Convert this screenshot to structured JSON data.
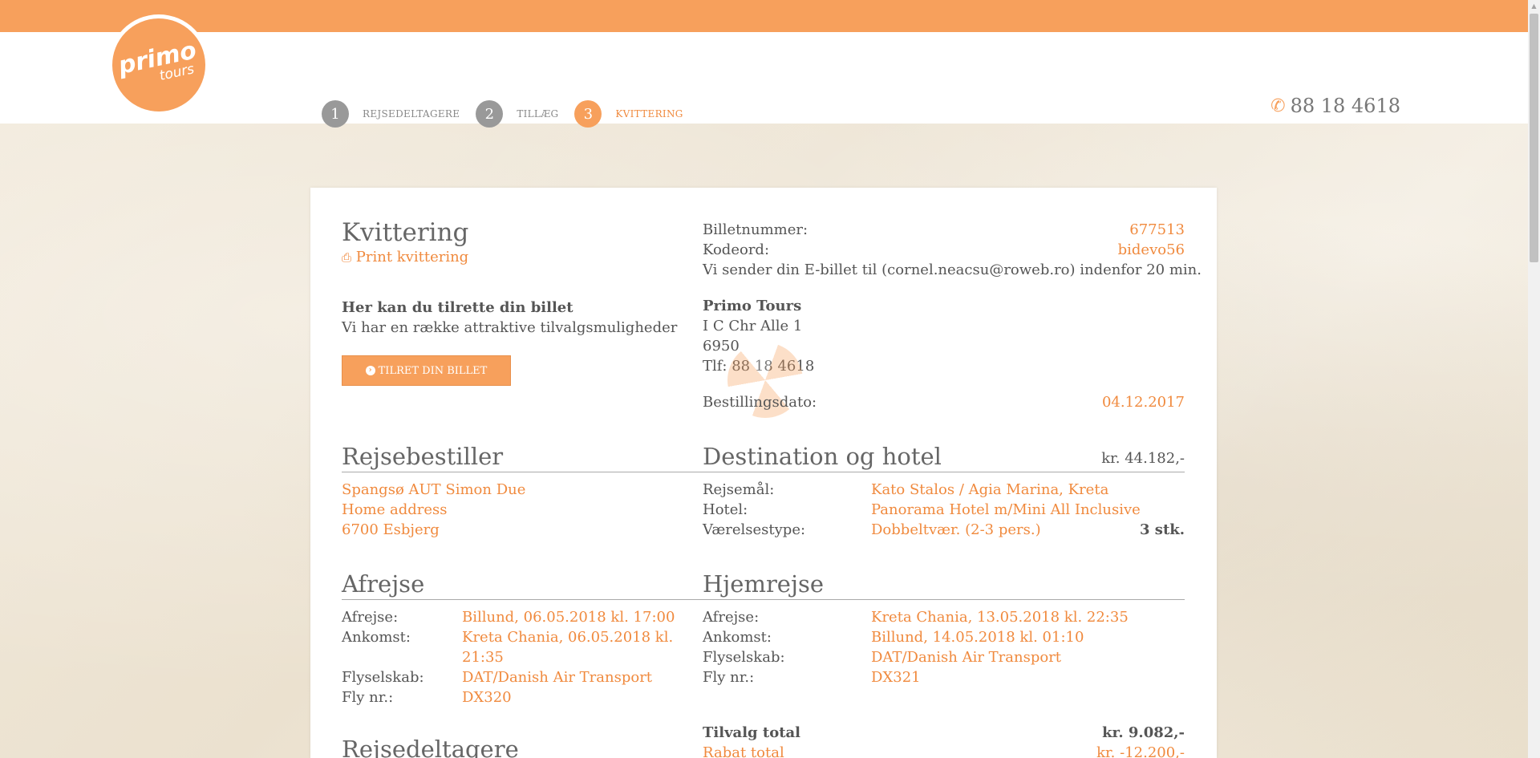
{
  "header": {
    "logo_line1": "primo",
    "logo_line2": "tours",
    "steps": [
      {
        "num": "1",
        "label": "REJSEDELTAGERE"
      },
      {
        "num": "2",
        "label": "TILLÆG"
      },
      {
        "num": "3",
        "label": "KVITTERING"
      }
    ],
    "phone": "88 18 4618",
    "phone_icon": "phone-icon"
  },
  "receipt": {
    "title": "Kvittering",
    "print_label": "Print kvittering",
    "customize_title": "Her kan du tilrette din billet",
    "customize_sub": "Vi har en række attraktive tilvalgsmuligheder",
    "customize_button": "TILRET DIN BILLET",
    "ticket_label": "Billetnummer:",
    "ticket_value": "677513",
    "code_label": "Kodeord:",
    "code_value": "bidevo56",
    "email_note": "Vi sender din E-billet til (cornel.neacsu@roweb.ro) indenfor 20 min.",
    "company_name": "Primo Tours",
    "company_addr": "I C Chr Alle 1",
    "company_zip": "6950",
    "company_phone": "Tlf: 88 18 4618",
    "order_date_label": "Bestillingsdato:",
    "order_date_value": "04.12.2017"
  },
  "booker": {
    "title": "Rejsebestiller",
    "name": "Spangsø AUT Simon Due",
    "address": "Home address",
    "city": "6700 Esbjerg"
  },
  "destination": {
    "title": "Destination og hotel",
    "price": "kr. 44.182,-",
    "dest_label": "Rejsemål:",
    "dest_value": "Kato Stalos / Agia Marina, Kreta",
    "hotel_label": "Hotel:",
    "hotel_value": "Panorama Hotel m/Mini All Inclusive",
    "room_label": "Værelsestype:",
    "room_value": "Dobbeltvær. (2-3 pers.)",
    "room_count": "3 stk."
  },
  "outbound": {
    "title": "Afrejse",
    "dep_label": "Afrejse:",
    "dep_value": "Billund, 06.05.2018 kl. 17:00",
    "arr_label": "Ankomst:",
    "arr_value_1": "Kreta Chania, 06.05.2018 kl.",
    "arr_value_2": "21:35",
    "airline_label": "Flyselskab:",
    "airline_value": "DAT/Danish Air Transport",
    "flight_label": "Fly nr.:",
    "flight_value": "DX320"
  },
  "return": {
    "title": "Hjemrejse",
    "dep_label": "Afrejse:",
    "dep_value": "Kreta Chania, 13.05.2018 kl. 22:35",
    "arr_label": "Ankomst:",
    "arr_value": "Billund, 14.05.2018 kl. 01:10",
    "airline_label": "Flyselskab:",
    "airline_value": "DAT/Danish Air Transport",
    "flight_label": "Fly nr.:",
    "flight_value": "DX321"
  },
  "totals": {
    "addons_label": "Tilvalg total",
    "addons_value": "kr. 9.082,-",
    "discount_label": "Rabat total",
    "discount_value": "kr. -12.200,-"
  },
  "participants": {
    "title": "Rejsedeltagere"
  },
  "colors": {
    "accent": "#f7a05c",
    "accent_text": "#f08a3e"
  }
}
